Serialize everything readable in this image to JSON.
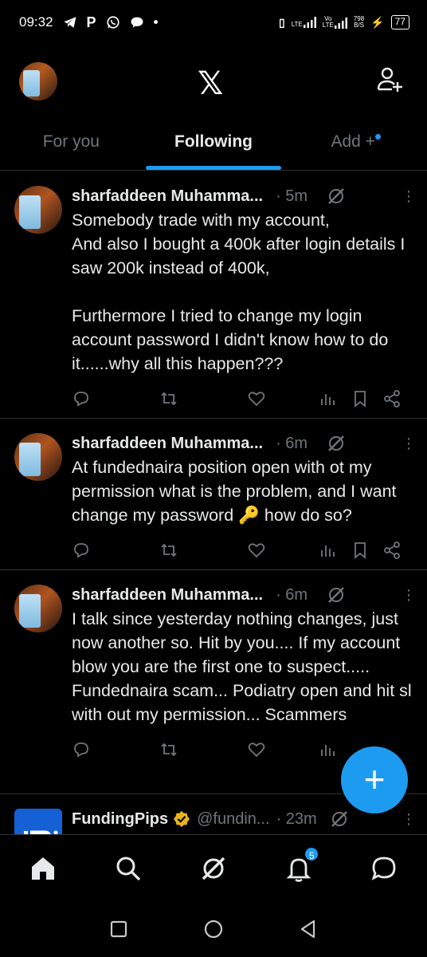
{
  "status": {
    "time": "09:32",
    "speed_value": "798",
    "speed_unit": "B/S",
    "battery": "77",
    "lte1": "LTE",
    "vo": "Vo",
    "lte2": "LTE"
  },
  "tabs": [
    {
      "label": "For you"
    },
    {
      "label": "Following"
    },
    {
      "label": "Add +"
    }
  ],
  "tweets": [
    {
      "name": "sharfaddeen Muhamma...",
      "time": "· 5m",
      "body": "Somebody trade with my account,\nAnd also I bought a 400k after login details I saw 200k instead of 400k,\n\nFurthermore I tried to change my login account password I didn't know how to do it......why all this happen???"
    },
    {
      "name": "sharfaddeen Muhamma...",
      "time": "· 6m",
      "body": "At fundednaira position open with ot my permission what is the problem, and I want change my password 🔑 how do so?"
    },
    {
      "name": "sharfaddeen Muhamma...",
      "time": "· 6m",
      "body": "I talk since yesterday nothing changes, just now another so. Hit by you.... If my account blow you are the first one to suspect..... Fundednaira scam... Podiatry open and hit sl with out my permission... Scammers"
    },
    {
      "name": "FundingPips",
      "handle": "@fundin...",
      "time": "· 23m"
    }
  ],
  "nav": {
    "notifications_badge": "5"
  },
  "colors": {
    "accent": "#1d9bf0",
    "background": "#000000",
    "verified": "#e8b41a"
  },
  "icons": [
    "telegram-icon",
    "p-icon",
    "whatsapp-icon",
    "chat-bubble-icon",
    "x-logo-icon",
    "add-user-icon",
    "grok-icon",
    "more-icon",
    "reply-icon",
    "retweet-icon",
    "like-icon",
    "views-icon",
    "bookmark-icon",
    "share-icon",
    "home-icon",
    "search-icon",
    "grok-nav-icon",
    "bell-icon",
    "messages-icon",
    "compose-icon"
  ]
}
